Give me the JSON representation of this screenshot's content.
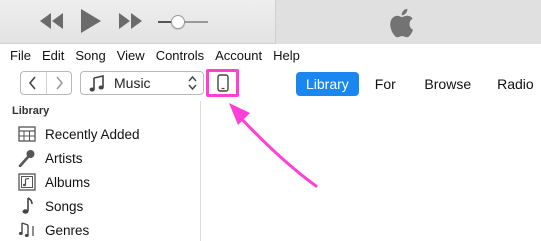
{
  "menu": {
    "items": [
      "File",
      "Edit",
      "Song",
      "View",
      "Controls",
      "Account",
      "Help"
    ]
  },
  "toolbar": {
    "media_type": "Music",
    "tabs": {
      "library": "Library",
      "for_you": "For You",
      "browse": "Browse",
      "radio": "Radio"
    },
    "active_tab": "Library"
  },
  "player": {
    "volume_level": 0.35
  },
  "sidebar": {
    "heading": "Library",
    "items": [
      {
        "label": "Recently Added",
        "icon": "grid-calendar-icon"
      },
      {
        "label": "Artists",
        "icon": "microphone-icon"
      },
      {
        "label": "Albums",
        "icon": "album-icon"
      },
      {
        "label": "Songs",
        "icon": "music-note-icon"
      },
      {
        "label": "Genres",
        "icon": "genres-icon"
      }
    ]
  },
  "colors": {
    "accent": "#1a86f0",
    "annotation": "#ff3fd6"
  }
}
